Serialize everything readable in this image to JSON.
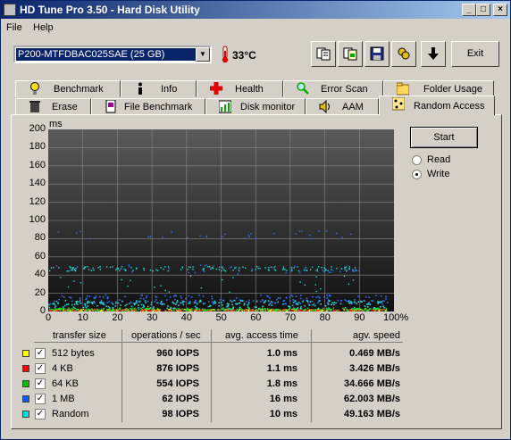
{
  "window": {
    "title": "HD Tune Pro 3.50 - Hard Disk Utility",
    "min": "_",
    "max": "□",
    "close": "×"
  },
  "menu": [
    {
      "label": "File",
      "key": "F"
    },
    {
      "label": "Help",
      "key": "H"
    }
  ],
  "toolbar": {
    "drive": "P200-MTFDBAC025SAE (25 GB)",
    "temperature": "33°C",
    "exit_label": "Exit",
    "icons": [
      "copy-info-icon",
      "copy-screen-icon",
      "save-icon",
      "options-icon",
      "down-arrow-icon"
    ]
  },
  "tabs_row1": [
    {
      "label": "Benchmark",
      "icon": "bulb-icon"
    },
    {
      "label": "Info",
      "icon": "info-icon"
    },
    {
      "label": "Health",
      "icon": "cross-icon"
    },
    {
      "label": "Error Scan",
      "icon": "magnifier-icon"
    },
    {
      "label": "Folder Usage",
      "icon": "folder-icon"
    }
  ],
  "tabs_row2": [
    {
      "label": "Erase",
      "icon": "trash-icon"
    },
    {
      "label": "File Benchmark",
      "icon": "file-icon"
    },
    {
      "label": "Disk monitor",
      "icon": "monitor-chart-icon"
    },
    {
      "label": "AAM",
      "icon": "speaker-icon"
    },
    {
      "label": "Random Access",
      "icon": "random-access-icon",
      "active": true
    }
  ],
  "controls": {
    "start_label": "Start",
    "read_label": "Read",
    "write_label": "Write",
    "mode": "Write"
  },
  "chart_data": {
    "type": "scatter",
    "ylabel": "ms",
    "y_ticks": [
      "200",
      "180",
      "160",
      "140",
      "120",
      "100",
      "80",
      "60",
      "40",
      "20",
      "0"
    ],
    "x_ticks": [
      "0",
      "10",
      "20",
      "30",
      "40",
      "50",
      "60",
      "70",
      "80",
      "90",
      "100%"
    ],
    "ylim": [
      0,
      200
    ],
    "xlim": [
      0,
      100
    ],
    "grid": true,
    "series": [
      {
        "name": "512 bytes",
        "color": "#ffff00",
        "band": [
          0.3,
          2.0
        ],
        "points": 220
      },
      {
        "name": "4 KB",
        "color": "#ff2020",
        "band": [
          0.3,
          2.0
        ],
        "points": 220
      },
      {
        "name": "64 KB",
        "color": "#20e020",
        "band": [
          0.5,
          3.5
        ],
        "points": 220
      },
      {
        "name": "1 MB",
        "color": "#3070ff",
        "band": [
          8,
          18
        ],
        "points": 180
      },
      {
        "name": "Random",
        "color": "#20e0e0",
        "band": [
          3,
          12
        ],
        "points": 220
      }
    ]
  },
  "table": {
    "headers": [
      "transfer size",
      "operations / sec",
      "avg. access time",
      "agv. speed"
    ],
    "rows": [
      {
        "label": "512 bytes",
        "color": "#ffff00",
        "checked": "✓",
        "ops": "960 IOPS",
        "access": "1.0 ms",
        "speed": "0.469 MB/s"
      },
      {
        "label": "4 KB",
        "color": "#ff0000",
        "checked": "✓",
        "ops": "876 IOPS",
        "access": "1.1 ms",
        "speed": "3.426 MB/s"
      },
      {
        "label": "64 KB",
        "color": "#00c000",
        "checked": "✓",
        "ops": "554 IOPS",
        "access": "1.8 ms",
        "speed": "34.666 MB/s"
      },
      {
        "label": "1 MB",
        "color": "#0060ff",
        "checked": "✓",
        "ops": "62 IOPS",
        "access": "16 ms",
        "speed": "62.003 MB/s"
      },
      {
        "label": "Random",
        "color": "#00e0e0",
        "checked": "✓",
        "ops": "98 IOPS",
        "access": "10 ms",
        "speed": "49.163 MB/s"
      }
    ]
  }
}
